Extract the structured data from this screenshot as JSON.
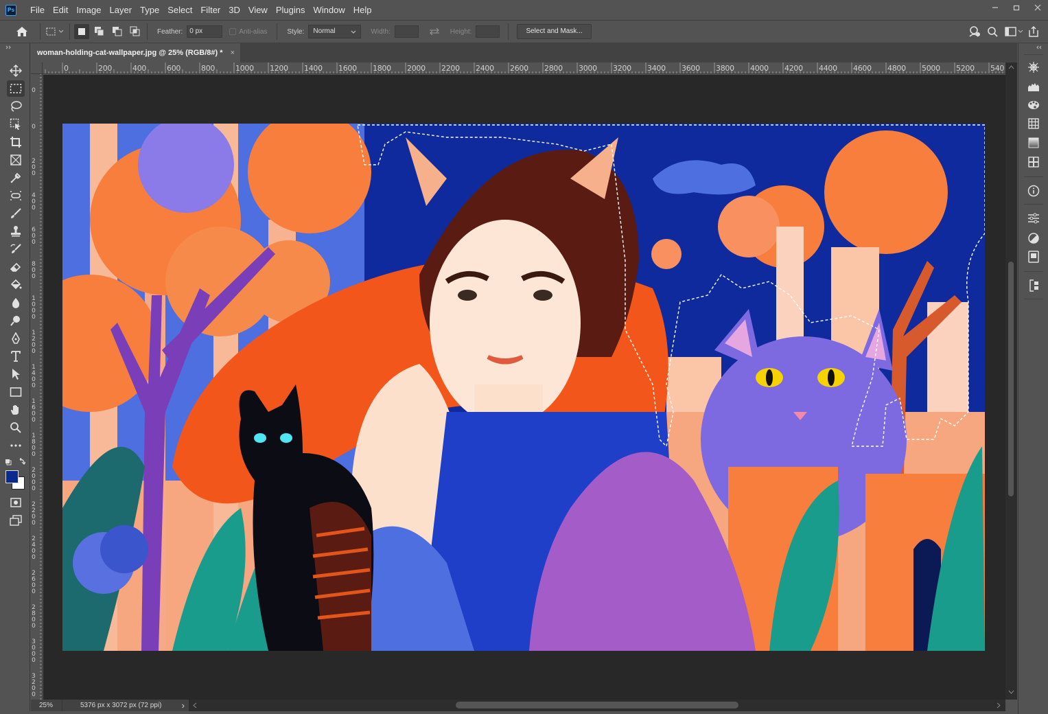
{
  "app": {
    "logo_text": "Ps",
    "menu": [
      "File",
      "Edit",
      "Image",
      "Layer",
      "Type",
      "Select",
      "Filter",
      "3D",
      "View",
      "Plugins",
      "Window",
      "Help"
    ]
  },
  "options": {
    "feather_label": "Feather:",
    "feather_value": "0 px",
    "antialias_label": "Anti-alias",
    "style_label": "Style:",
    "style_value": "Normal",
    "width_label": "Width:",
    "height_label": "Height:",
    "select_mask_label": "Select and Mask..."
  },
  "document": {
    "tab_title": "woman-holding-cat-wallpaper.jpg @ 25% (RGB/8#) *",
    "tab_close": "×"
  },
  "rulers": {
    "top": [
      "0",
      "200",
      "400",
      "600",
      "800",
      "1000",
      "1200",
      "1400",
      "1600",
      "1800",
      "2000",
      "2200",
      "2400",
      "2600",
      "2800",
      "3000",
      "3200",
      "3400",
      "3600",
      "3800",
      "4000",
      "4200",
      "4400",
      "4600",
      "4800",
      "5000",
      "5200",
      "540"
    ],
    "left": [
      "0",
      "0",
      "2 0 0",
      "4 0 0",
      "6 0 0",
      "8 0 0",
      "1 0 0 0",
      "1 2 0 0",
      "1 4 0 0",
      "1 6 0 0",
      "1 8 0 0",
      "2 0 0 0",
      "2 2 0 0",
      "2 4 0 0",
      "2 6 0 0",
      "2 8 0 0",
      "3 0 0 0",
      "3 2 0 0"
    ]
  },
  "status": {
    "zoom": "25%",
    "doc_info": "5376 px x 3072 px (72 ppi)",
    "arrow": "›"
  },
  "colors": {
    "foreground": "#0a2a8f",
    "background": "#ffffff"
  }
}
